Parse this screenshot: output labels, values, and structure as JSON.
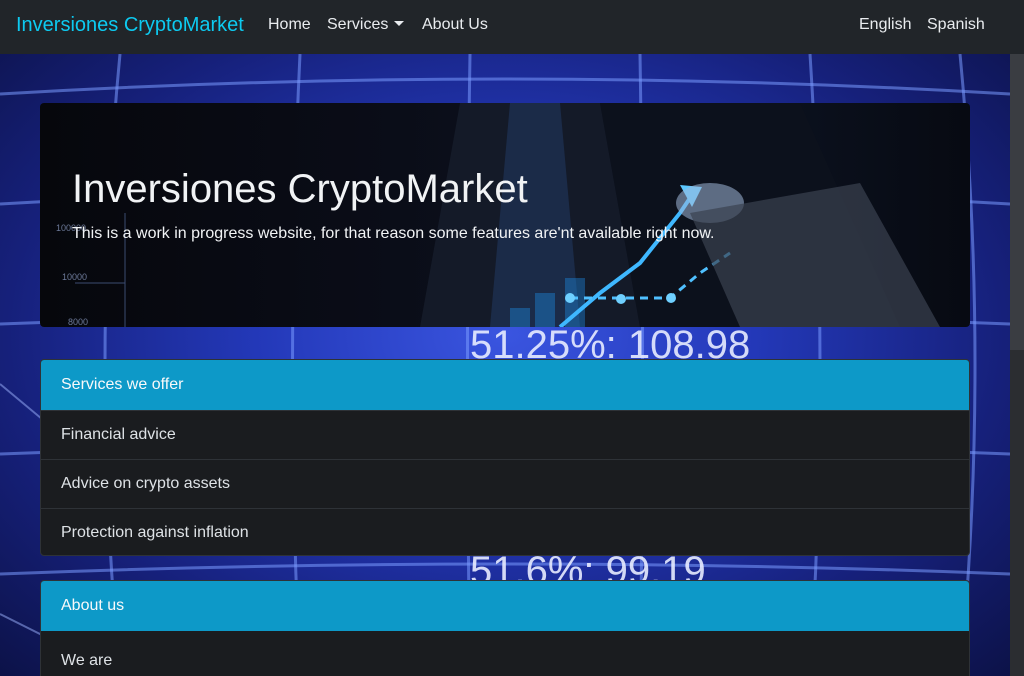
{
  "navbar": {
    "brand": "Inversiones CryptoMarket",
    "links": {
      "home": "Home",
      "services": "Services",
      "about": "About Us"
    },
    "languages": {
      "english": "English",
      "spanish": "Spanish"
    }
  },
  "background": {
    "figures": {
      "upper": "51.25%: 108.98",
      "lower": "51.6%: 99.19"
    }
  },
  "hero": {
    "title": "Inversiones CryptoMarket",
    "text": "This is a work in progress website, for that reason some features are'nt available right now.",
    "chart_ticks": [
      "100000",
      "10000",
      "8000"
    ]
  },
  "services_card": {
    "header": "Services we offer",
    "items": [
      "Financial advice",
      "Advice on crypto assets",
      "Protection against inflation"
    ]
  },
  "about_card": {
    "header": "About us",
    "body": "We are"
  },
  "colors": {
    "brand": "#0dcaf0",
    "card_header": "#0d99c8",
    "navbar": "#212529",
    "card_body": "#1a1c1f"
  }
}
